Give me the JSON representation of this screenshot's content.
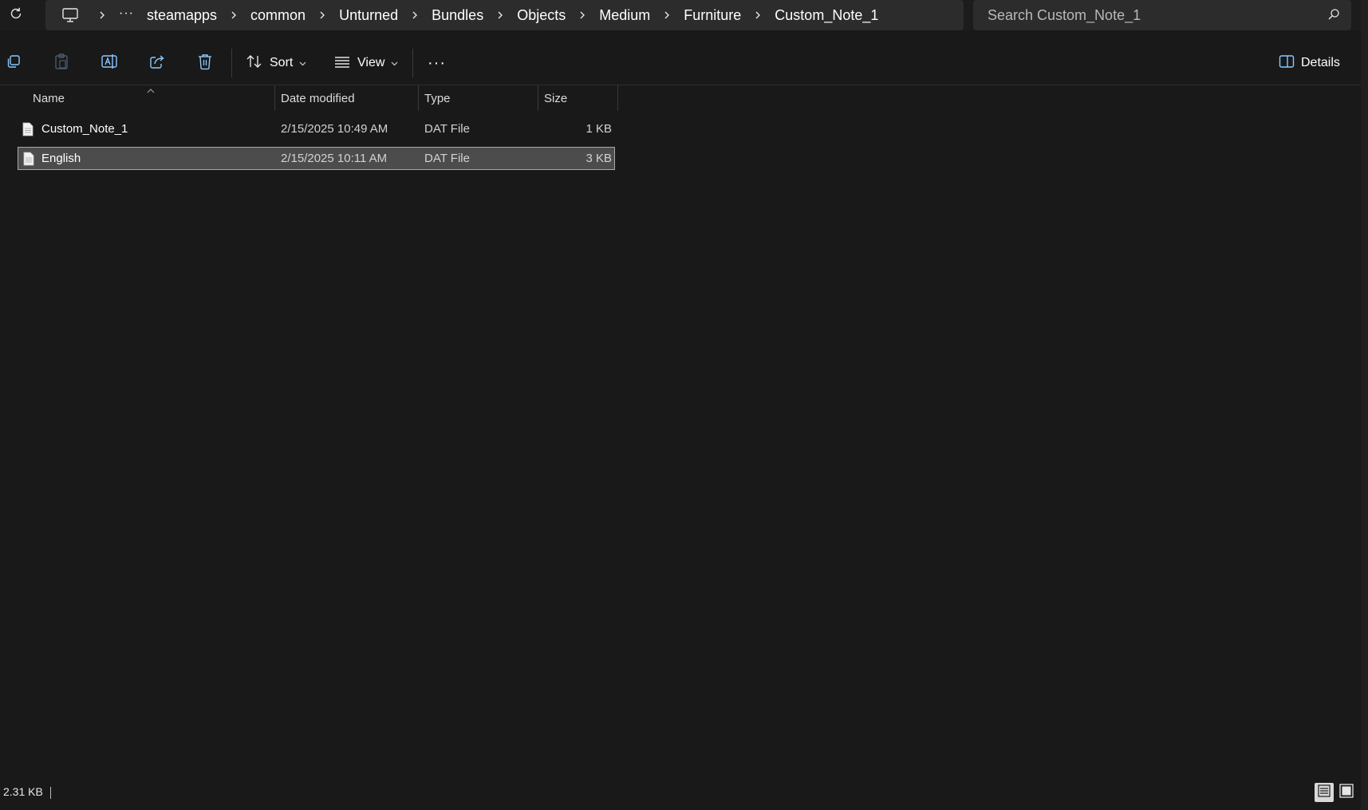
{
  "address_bar": {
    "root_icon": "computer-icon",
    "overflow_label": "···",
    "crumbs": [
      "steamapps",
      "common",
      "Unturned",
      "Bundles",
      "Objects",
      "Medium",
      "Furniture",
      "Custom_Note_1"
    ]
  },
  "search": {
    "placeholder": "Search Custom_Note_1"
  },
  "command_bar": {
    "icons": [
      "copy-icon",
      "paste-icon",
      "rename-icon",
      "share-icon",
      "delete-icon"
    ],
    "sort_label": "Sort",
    "view_label": "View",
    "more_label": "···",
    "details_label": "Details"
  },
  "columns": {
    "name": "Name",
    "date_modified": "Date modified",
    "type": "Type",
    "size": "Size"
  },
  "files": [
    {
      "name": "Custom_Note_1",
      "date_modified": "2/15/2025 10:49 AM",
      "type": "DAT File",
      "size": "1 KB",
      "selected": false
    },
    {
      "name": "English",
      "date_modified": "2/15/2025 10:11 AM",
      "type": "DAT File",
      "size": "3 KB",
      "selected": true
    }
  ],
  "status": {
    "selection_size": "2.31 KB"
  },
  "colors": {
    "background": "#191919",
    "field": "#2c2c2c",
    "selection": "#4c4c4c",
    "selection_border": "#a8a8a8",
    "accent_icon": "#8cc8ff"
  }
}
